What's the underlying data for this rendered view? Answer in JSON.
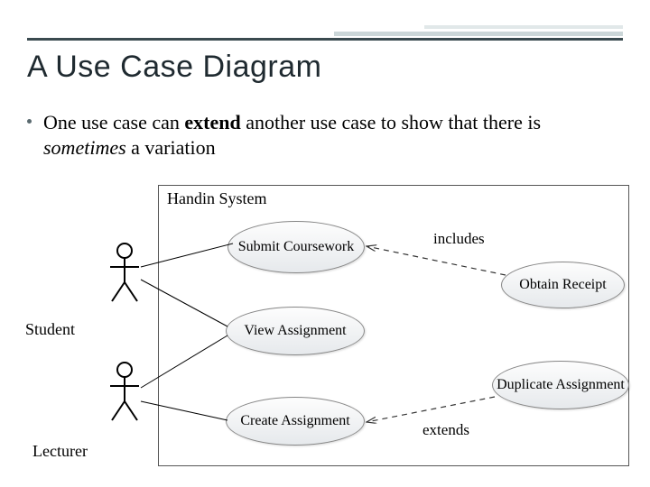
{
  "title": "A Use Case Diagram",
  "bullet_html_parts": {
    "p1": "One use case can ",
    "extend": "extend",
    "p2": " another use case to show that there is ",
    "sometimes": "sometimes",
    "p3": " a variation"
  },
  "system_label": "Handin System",
  "actors": {
    "student": "Student",
    "lecturer": "Lecturer"
  },
  "usecases": {
    "submit": "Submit Coursework",
    "view": "View Assignment",
    "create": "Create Assignment",
    "obtain": "Obtain Receipt",
    "duplicate": "Duplicate Assignment"
  },
  "relations": {
    "includes": "includes",
    "extends": "extends"
  },
  "chart_data": {
    "type": "uml-use-case",
    "system": "Handin System",
    "actors": [
      "Student",
      "Lecturer"
    ],
    "use_cases": [
      "Submit Coursework",
      "View Assignment",
      "Create Assignment",
      "Obtain Receipt",
      "Duplicate Assignment"
    ],
    "associations": [
      {
        "actor": "Student",
        "use_case": "Submit Coursework"
      },
      {
        "actor": "Student",
        "use_case": "View Assignment"
      },
      {
        "actor": "Lecturer",
        "use_case": "View Assignment"
      },
      {
        "actor": "Lecturer",
        "use_case": "Create Assignment"
      }
    ],
    "include": [
      {
        "base": "Submit Coursework",
        "included": "Obtain Receipt",
        "label": "includes"
      }
    ],
    "extend": [
      {
        "extension": "Duplicate Assignment",
        "base": "Create Assignment",
        "label": "extends"
      }
    ]
  }
}
